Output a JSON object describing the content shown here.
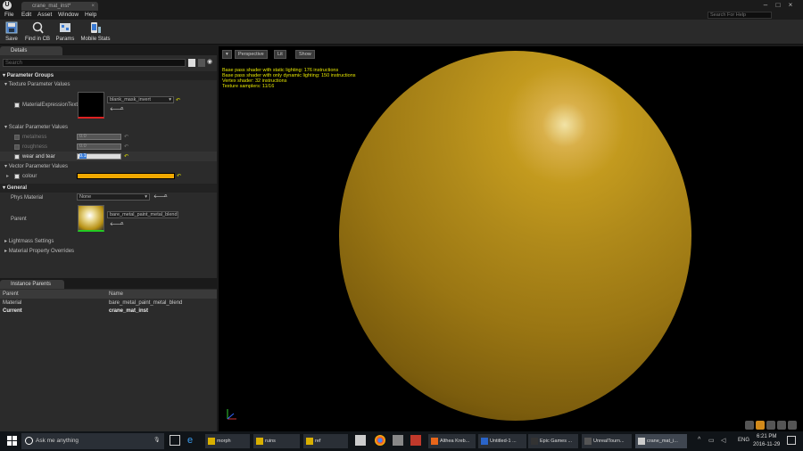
{
  "titlebar": {
    "tab_title": "crane_mat_inst*",
    "search_help": "Search For Help"
  },
  "menubar": [
    "File",
    "Edit",
    "Asset",
    "Window",
    "Help"
  ],
  "toolbar": [
    {
      "label": "Save",
      "icon": "save-icon"
    },
    {
      "label": "Find in CB",
      "icon": "search-icon"
    },
    {
      "label": "Params",
      "icon": "params-icon"
    },
    {
      "label": "Mobile Stats",
      "icon": "mobile-stats-icon"
    }
  ],
  "details": {
    "tab": "Details",
    "search_placeholder": "Search",
    "parameter_groups": "Parameter Groups",
    "texture_group": "Texture Parameter Values",
    "texture_param": "MaterialExpressionTextu",
    "texture_value": "blank_mask_invert",
    "scalar_group": "Scalar Parameter Values",
    "scalars": [
      {
        "name": "metalness",
        "value": "0.0",
        "enabled": false
      },
      {
        "name": "roughness",
        "value": "0.0",
        "enabled": false
      },
      {
        "name": "wear and tear",
        "value": "0.1",
        "enabled": true
      }
    ],
    "vector_group": "Vector Parameter Values",
    "vector_param": "colour",
    "colour_swatch": "#f0a800",
    "general": "General",
    "phys_material_label": "Phys Material",
    "phys_material_value": "None",
    "parent_label": "Parent",
    "parent_value": "bare_metal_paint_metal_blend",
    "lightmass": "Lightmass Settings",
    "material_overrides": "Material Property Overrides"
  },
  "viewport": {
    "perspective": "Perspective",
    "lit": "Lit",
    "show": "Show",
    "stats": [
      "Base pass shader with static lighting: 176 instructions",
      "Base pass shader with only dynamic lighting: 150 instructions",
      "Vertex shader: 32 instructions",
      "Texture samplers: 11/16"
    ]
  },
  "instance_parents": {
    "tab": "Instance Parents",
    "col_parent": "Parent",
    "col_name": "Name",
    "rows": [
      {
        "parent": "Material",
        "name": "bare_metal_paint_metal_blend"
      },
      {
        "parent": "Current",
        "name": "crane_mat_inst"
      }
    ]
  },
  "taskbar": {
    "search": "Ask me anything",
    "apps": [
      "morph",
      "ruins",
      "ref",
      "Althea Kreb...",
      "Untitled-1 ...",
      "Epic Games ...",
      "UnrealTourn...",
      "crane_mat_i..."
    ],
    "lang": "ENG",
    "time": "6:21 PM",
    "date": "2016-11-29"
  }
}
